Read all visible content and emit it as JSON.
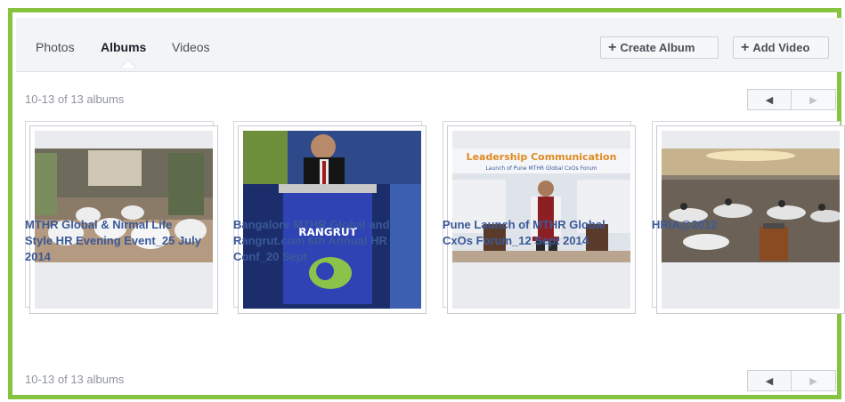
{
  "tabs": [
    {
      "label": "Photos",
      "active": false
    },
    {
      "label": "Albums",
      "active": true
    },
    {
      "label": "Videos",
      "active": false
    }
  ],
  "actions": {
    "create_album": "Create Album",
    "add_video": "Add Video",
    "plus": "+"
  },
  "pagination": {
    "range_text": "10-13 of 13 albums",
    "prev": "◀",
    "next": "▶"
  },
  "albums": [
    {
      "title": "MTHR Global & Nirmal Life Style HR Evening Event_25 July 2014",
      "photo": "banquet-hall-photo"
    },
    {
      "title": "Bangalore MTHR Global and Rangrut.com 6th Annual HR Conf_20 Sept",
      "photo": "speaker-podium-photo"
    },
    {
      "title": "Pune Launch of MTHR Global CxOs Forum_12 Sept 2014",
      "photo": "presenter-stage-photo"
    },
    {
      "title": "HRIA@2012",
      "photo": "conference-hall-photo"
    }
  ],
  "photo_text": {
    "podium_brand": "RANGRUT",
    "banner_line1": "Leadership Communication",
    "banner_line2": "Launch of Pune MTHR Global CxOs Forum"
  },
  "colors": {
    "frame_border": "#86c440",
    "link": "#3b5998"
  }
}
